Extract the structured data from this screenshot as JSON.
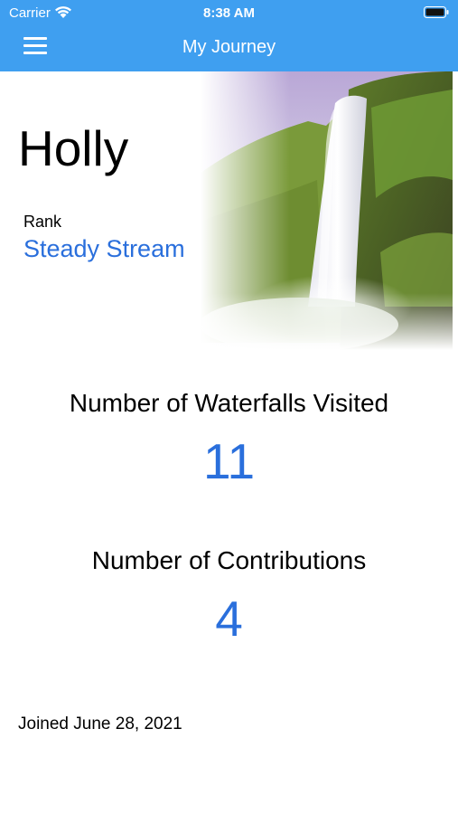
{
  "status_bar": {
    "carrier": "Carrier",
    "time": "8:38 AM",
    "wifi_icon": "wifi-icon",
    "battery_icon": "battery-icon"
  },
  "nav": {
    "title": "My Journey",
    "menu_icon": "hamburger-menu-icon",
    "color": "#3f9ff0"
  },
  "profile": {
    "name": "Holly",
    "rank_label": "Rank",
    "rank_value": "Steady Stream",
    "hero_image": "waterfall-photo"
  },
  "stats": {
    "waterfalls_label": "Number of Waterfalls Visited",
    "waterfalls_value": "11",
    "contributions_label": "Number of Contributions",
    "contributions_value": "4"
  },
  "footer": {
    "joined": "Joined June 28, 2021"
  },
  "colors": {
    "accent": "#2a6fdc",
    "bar": "#3f9ff0"
  }
}
